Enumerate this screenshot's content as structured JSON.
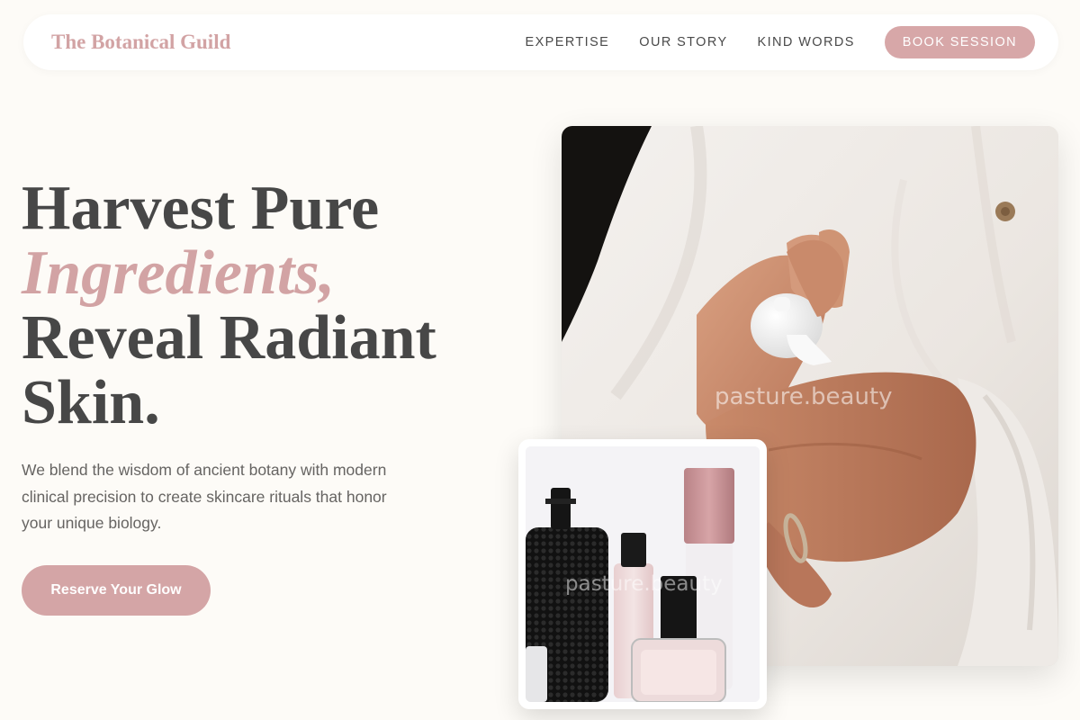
{
  "brand": {
    "name": "The Botanical Guild"
  },
  "nav": {
    "links": [
      "EXPERTISE",
      "OUR STORY",
      "KIND WORDS"
    ],
    "cta": "BOOK SESSION"
  },
  "hero": {
    "headline": {
      "line1": "Harvest Pure",
      "line2": "Ingredients,",
      "line3": "Reveal Radiant",
      "line4": "Skin."
    },
    "description": "We blend the wisdom of ancient botany with modern clinical precision to create skincare rituals that honor your unique biology.",
    "cta": "Reserve Your Glow"
  },
  "images": {
    "main": {
      "watermark": "pasture.beauty",
      "subject": "hands-pump-bottle"
    },
    "secondary": {
      "watermark": "pasture.beauty",
      "subject": "perfume-bottles"
    }
  },
  "colors": {
    "background": "#fdfbf7",
    "accent": "#d4a5a6",
    "text": "#474747",
    "body_text": "#666462"
  }
}
